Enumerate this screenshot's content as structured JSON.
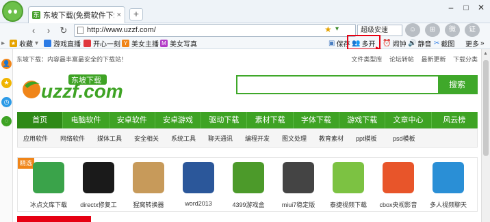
{
  "tab": {
    "title": "东坡下载(免费软件下载网",
    "close": "×"
  },
  "newtab": "+",
  "window": {
    "min": "–",
    "max": "□",
    "close": "✕"
  },
  "nav": {
    "url": "http://www.uzzf.com/",
    "speed_label": "超级安速"
  },
  "right_icons": [
    "☺",
    "⊞",
    "微",
    "证"
  ],
  "bookmarks": [
    {
      "label": "收藏",
      "color": "#e6a300"
    },
    {
      "label": "游戏直播",
      "color": "#2c7be5"
    },
    {
      "label": "开心一刻",
      "color": "#e0383e"
    },
    {
      "label": "美女主播",
      "color": "#f08519"
    },
    {
      "label": "美女写真",
      "color": "#b23cc7"
    }
  ],
  "toolbar": {
    "save": "保存",
    "multi": "多开",
    "clock": "闹钟",
    "mute": "静音",
    "screenshot": "截图",
    "more": "更多"
  },
  "page": {
    "tagline": "东坡下载：内容最丰富最安全的下载站！",
    "toplinks": [
      "文件类型库",
      "论坛转帖",
      "最新更新",
      "下载分类"
    ],
    "logo_text": "uzzf.com",
    "logo_tag": "东坡下载",
    "search_button": "搜索",
    "mainnav": [
      "首页",
      "电脑软件",
      "安卓软件",
      "安卓游戏",
      "驱动下载",
      "素材下载",
      "字体下载",
      "游戏下载",
      "文章中心",
      "风云榜"
    ],
    "subnav": [
      "应用软件",
      "网络软件",
      "媒体工具",
      "安全相关",
      "系统工具",
      "聊天通讯",
      "编程开发",
      "图文处理",
      "教育素材",
      "ppt模板",
      "psd模板"
    ],
    "apps_badge": "精选",
    "apps": [
      {
        "label": "冰点文库下载",
        "color": "#3aa34a"
      },
      {
        "label": "directx修复工",
        "color": "#1a1a1a"
      },
      {
        "label": "猩窝转换器",
        "color": "#c79a5a"
      },
      {
        "label": "word2013",
        "color": "#2b579a"
      },
      {
        "label": "4399游戏盒",
        "color": "#4c9a2a"
      },
      {
        "label": "miui7稳定版",
        "color": "#444444"
      },
      {
        "label": "泰捷视频下载",
        "color": "#7cc242"
      },
      {
        "label": "cbox央视影音",
        "color": "#e8552a"
      },
      {
        "label": "多人视频聊天",
        "color": "#2a8fd6"
      }
    ]
  },
  "colors": {
    "brand_green": "#3ea324",
    "highlight": "#e60012"
  }
}
